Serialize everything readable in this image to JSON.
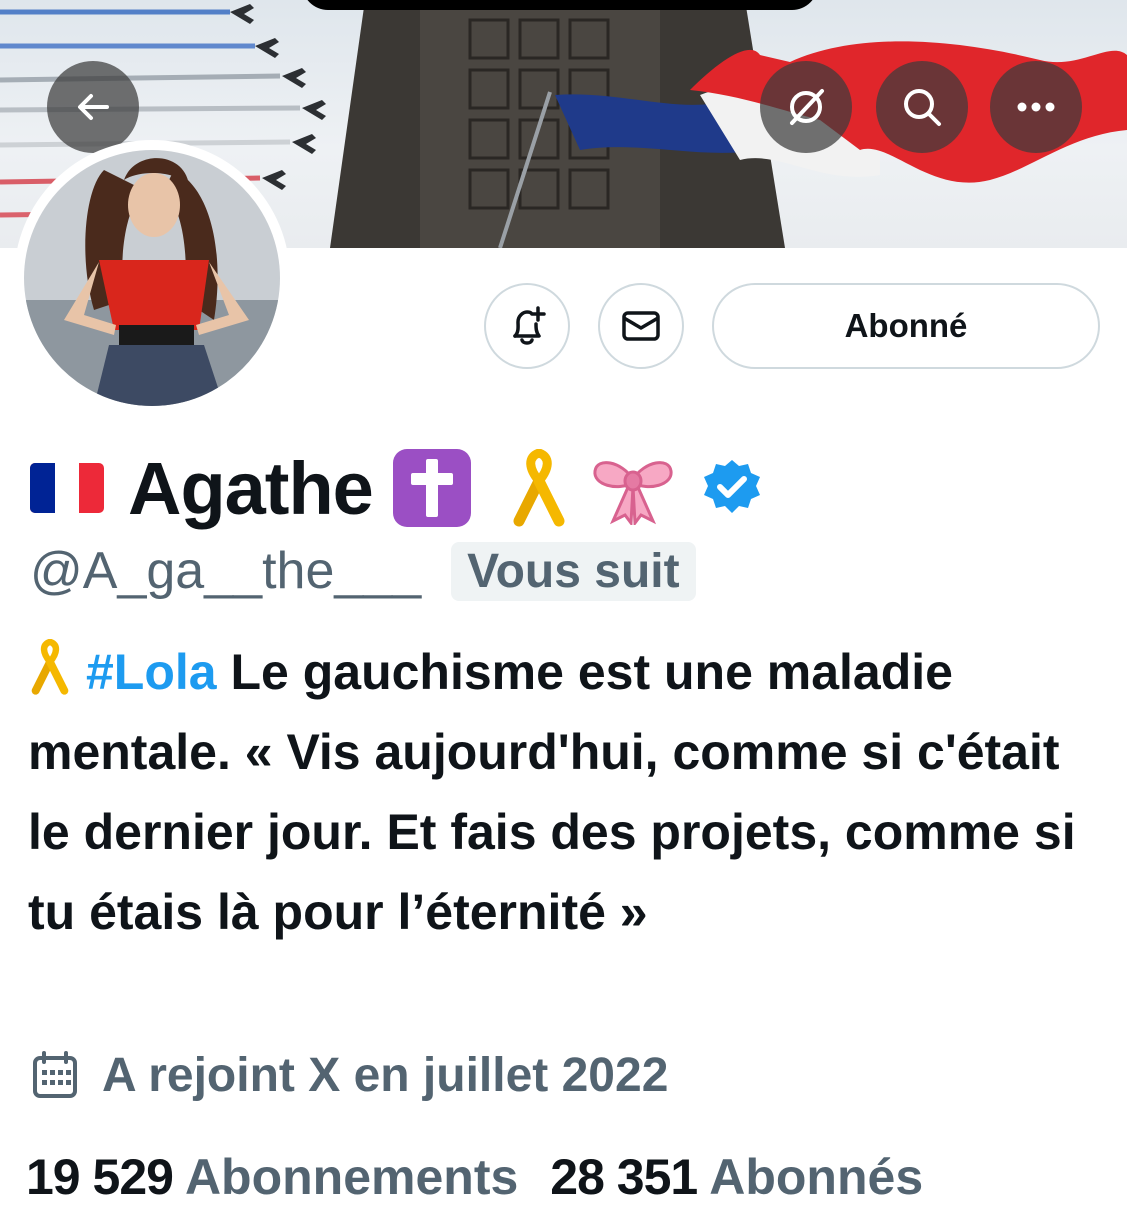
{
  "header": {
    "back_icon": "arrow-left-icon",
    "grok_icon": "grok-icon",
    "search_icon": "search-icon",
    "more_icon": "more-horizontal-icon"
  },
  "actions": {
    "notify_icon": "bell-plus-icon",
    "message_icon": "envelope-icon",
    "follow_label": "Abonné"
  },
  "profile": {
    "flag_emoji": "🇫🇷",
    "name": "Agathe",
    "name_emojis": [
      "✝️",
      "🎗️",
      "🎀"
    ],
    "verified_icon": "verified-badge-icon",
    "handle": "@A_ga__the___",
    "follows_you": "Vous suit"
  },
  "bio": {
    "ribbon": "🎗️",
    "hashtag": "#Lola",
    "text": " Le gauchisme est une maladie mentale. « Vis aujourd'hui, comme si c'était le dernier jour. Et fais des projets, comme si tu étais là pour l’éternité »"
  },
  "joined": {
    "icon": "calendar-icon",
    "text": "A rejoint X en juillet 2022"
  },
  "stats": {
    "following_count": "19 529",
    "following_label": "Abonnements",
    "followers_count": "28 351",
    "followers_label": "Abonnés"
  },
  "colors": {
    "accent": "#1d9bf0",
    "secondary_text": "#536471",
    "primary_text": "#0f1419",
    "border": "#cfd9de"
  }
}
